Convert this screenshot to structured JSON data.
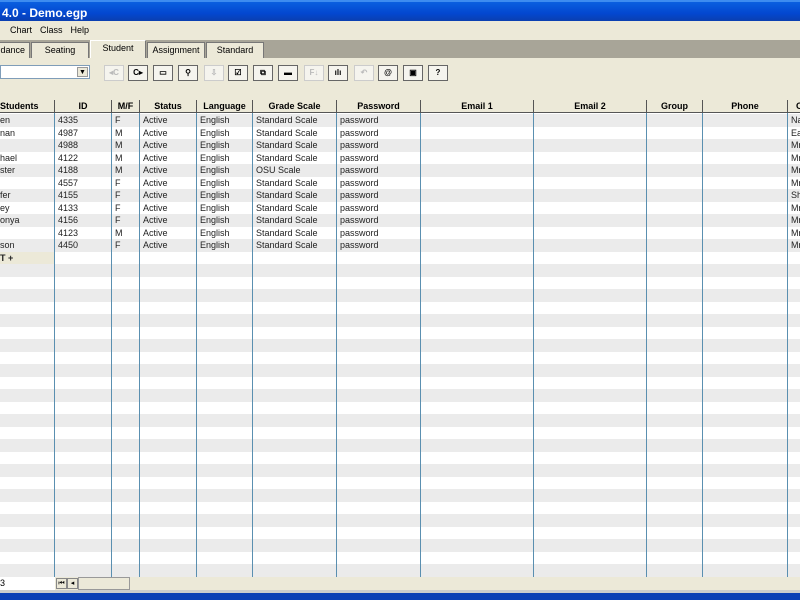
{
  "window": {
    "title": "4.0 - Demo.egp"
  },
  "menu": [
    "Chart",
    "Class",
    "Help"
  ],
  "tabs": [
    {
      "label": "dance"
    },
    {
      "label": "Seating"
    },
    {
      "label": "Student",
      "active": true
    },
    {
      "label": "Assignment"
    },
    {
      "label": "Standard"
    }
  ],
  "toolbar": {
    "combo_value": "",
    "buttons": [
      {
        "name": "prev-class",
        "glyph": "◂C",
        "disabled": true
      },
      {
        "name": "next-class",
        "glyph": "C▸"
      },
      {
        "name": "open-folder",
        "glyph": "▭"
      },
      {
        "name": "search",
        "glyph": "⚲"
      },
      {
        "name": "import",
        "glyph": "⇩",
        "disabled": true
      },
      {
        "name": "checkbox",
        "glyph": "☑"
      },
      {
        "name": "copy",
        "glyph": "⧉"
      },
      {
        "name": "print",
        "glyph": "▬"
      },
      {
        "name": "sort",
        "glyph": "F↓",
        "disabled": true
      },
      {
        "name": "chart",
        "glyph": "ılı"
      },
      {
        "name": "undo",
        "glyph": "↶",
        "disabled": true
      },
      {
        "name": "email",
        "glyph": "@"
      },
      {
        "name": "save",
        "glyph": "▣"
      },
      {
        "name": "help",
        "glyph": "?"
      }
    ]
  },
  "grid": {
    "columns": [
      "Students",
      "ID",
      "M/F",
      "Status",
      "Language",
      "Grade Scale",
      "Password",
      "Email 1",
      "Email 2",
      "Group",
      "Phone",
      "C"
    ],
    "rows": [
      [
        "en",
        "4335",
        "F",
        "Active",
        "English",
        "Standard Scale",
        "password",
        "",
        "",
        "",
        "",
        "Na"
      ],
      [
        "nan",
        "4987",
        "M",
        "Active",
        "English",
        "Standard Scale",
        "password",
        "",
        "",
        "",
        "",
        "Ea"
      ],
      [
        "",
        "4988",
        "M",
        "Active",
        "English",
        "Standard Scale",
        "password",
        "",
        "",
        "",
        "",
        "Mr"
      ],
      [
        "hael",
        "4122",
        "M",
        "Active",
        "English",
        "Standard Scale",
        "password",
        "",
        "",
        "",
        "",
        "Mr"
      ],
      [
        "ster",
        "4188",
        "M",
        "Active",
        "English",
        "OSU Scale",
        "password",
        "",
        "",
        "",
        "",
        "Mr"
      ],
      [
        "",
        "4557",
        "F",
        "Active",
        "English",
        "Standard Scale",
        "password",
        "",
        "",
        "",
        "",
        "Mr"
      ],
      [
        "fer",
        "4155",
        "F",
        "Active",
        "English",
        "Standard Scale",
        "password",
        "",
        "",
        "",
        "",
        "Sh"
      ],
      [
        "ey",
        "4133",
        "F",
        "Active",
        "English",
        "Standard Scale",
        "password",
        "",
        "",
        "",
        "",
        "Mr"
      ],
      [
        "onya",
        "4156",
        "F",
        "Active",
        "English",
        "Standard Scale",
        "password",
        "",
        "",
        "",
        "",
        "Mr"
      ],
      [
        "",
        "4123",
        "M",
        "Active",
        "English",
        "Standard Scale",
        "password",
        "",
        "",
        "",
        "",
        "Mr"
      ],
      [
        "son",
        "4450",
        "F",
        "Active",
        "English",
        "Standard Scale",
        "password",
        "",
        "",
        "",
        "",
        "Mr"
      ]
    ],
    "add_row_label": "T +"
  },
  "status": {
    "field_value": "3"
  }
}
